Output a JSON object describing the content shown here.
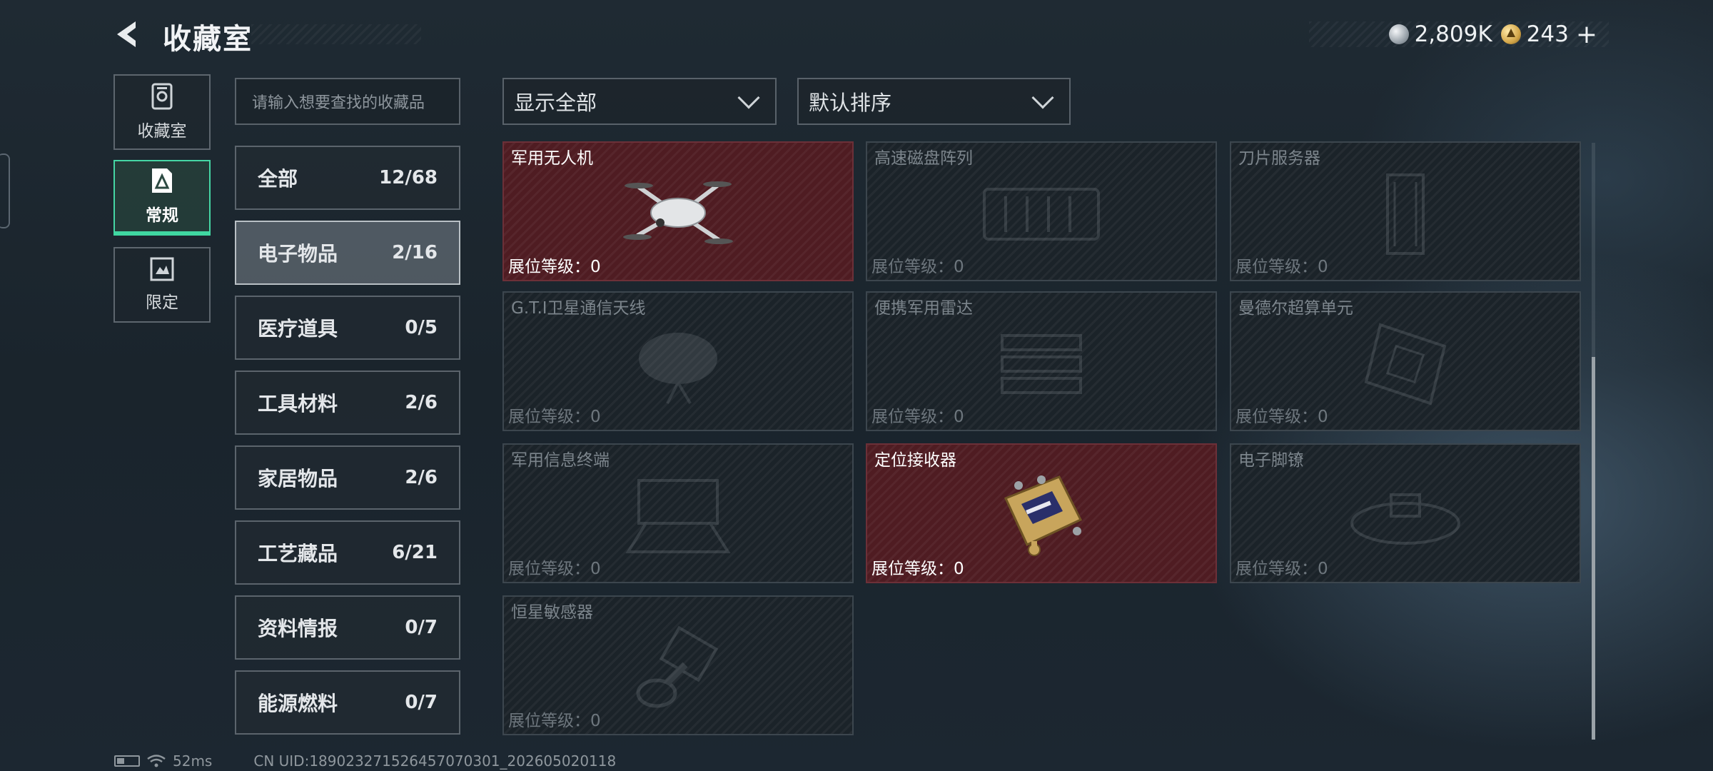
{
  "header": {
    "title": "收藏室"
  },
  "currency": {
    "silver": "2,809K",
    "gold": "243",
    "plus": "+"
  },
  "rail": [
    {
      "label": "收藏室",
      "icon": "vault-icon",
      "active": false
    },
    {
      "label": "常规",
      "icon": "normal-collection-icon",
      "active": true
    },
    {
      "label": "限定",
      "icon": "limited-collection-icon",
      "active": false
    }
  ],
  "search": {
    "placeholder": "请输入想要查找的收藏品"
  },
  "categories": [
    {
      "name": "全部",
      "count": "12/68"
    },
    {
      "name": "电子物品",
      "count": "2/16",
      "active": true
    },
    {
      "name": "医疗道具",
      "count": "0/5"
    },
    {
      "name": "工具材料",
      "count": "2/6"
    },
    {
      "name": "家居物品",
      "count": "2/6"
    },
    {
      "name": "工艺藏品",
      "count": "6/21"
    },
    {
      "name": "资料情报",
      "count": "0/7"
    },
    {
      "name": "能源燃料",
      "count": "0/7"
    }
  ],
  "filters": {
    "show": "显示全部",
    "sort": "默认排序"
  },
  "items": [
    {
      "name": "军用无人机",
      "level_label": "展位等级：",
      "level": "0",
      "owned": true,
      "icon": "drone-icon"
    },
    {
      "name": "高速磁盘阵列",
      "level_label": "展位等级：",
      "level": "0",
      "owned": false,
      "icon": "disk-array-icon"
    },
    {
      "name": "刀片服务器",
      "level_label": "展位等级：",
      "level": "0",
      "owned": false,
      "icon": "blade-server-icon"
    },
    {
      "name": "G.T.I卫星通信天线",
      "level_label": "展位等级：",
      "level": "0",
      "owned": false,
      "icon": "satellite-dish-icon"
    },
    {
      "name": "便携军用雷达",
      "level_label": "展位等级：",
      "level": "0",
      "owned": false,
      "icon": "radar-icon"
    },
    {
      "name": "曼德尔超算单元",
      "level_label": "展位等级：",
      "level": "0",
      "owned": false,
      "icon": "supercomputer-unit-icon"
    },
    {
      "name": "军用信息终端",
      "level_label": "展位等级：",
      "level": "0",
      "owned": false,
      "icon": "info-terminal-icon"
    },
    {
      "name": "定位接收器",
      "level_label": "展位等级：",
      "level": "0",
      "owned": true,
      "icon": "gps-receiver-icon"
    },
    {
      "name": "电子脚镣",
      "level_label": "展位等级：",
      "level": "0",
      "owned": false,
      "icon": "ankle-monitor-icon"
    },
    {
      "name": "恒星敏感器",
      "level_label": "展位等级：",
      "level": "0",
      "owned": false,
      "icon": "star-sensor-icon"
    }
  ],
  "status": {
    "ping": "52ms",
    "uid": "CN UID:18902327152645707030​1_202605020118"
  }
}
